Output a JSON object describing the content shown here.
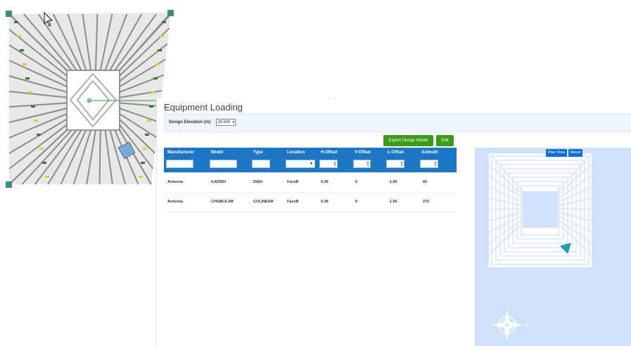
{
  "equipment_loading": {
    "title": "Equipment Loading",
    "design_elevation_label": "Design Elevation (m)",
    "design_elevation_value": "33.600"
  },
  "buttons": {
    "export": "Export Design Model",
    "edit": "Edit",
    "plan_view": "Plan View",
    "reset": "Reset"
  },
  "table": {
    "columns": [
      "Manufacturer",
      "Model",
      "Type",
      "Location",
      "H-Offset",
      "V-Offset",
      "L-Offset",
      "Azimuth"
    ],
    "rows": [
      [
        "Antenna",
        "0.6DISH",
        "DISH",
        "FaceB",
        "0.39",
        "0",
        "-1.56",
        "60"
      ],
      [
        "Antenna",
        "CHS88.9-2M",
        "COLINEAR",
        "FaceB",
        "0.39",
        "0",
        "-1.56",
        "270"
      ]
    ]
  },
  "colors": {
    "primary_blue": "#1d76c6",
    "action_green": "#3e9b1a",
    "plan_bg": "#cfe1fb"
  }
}
